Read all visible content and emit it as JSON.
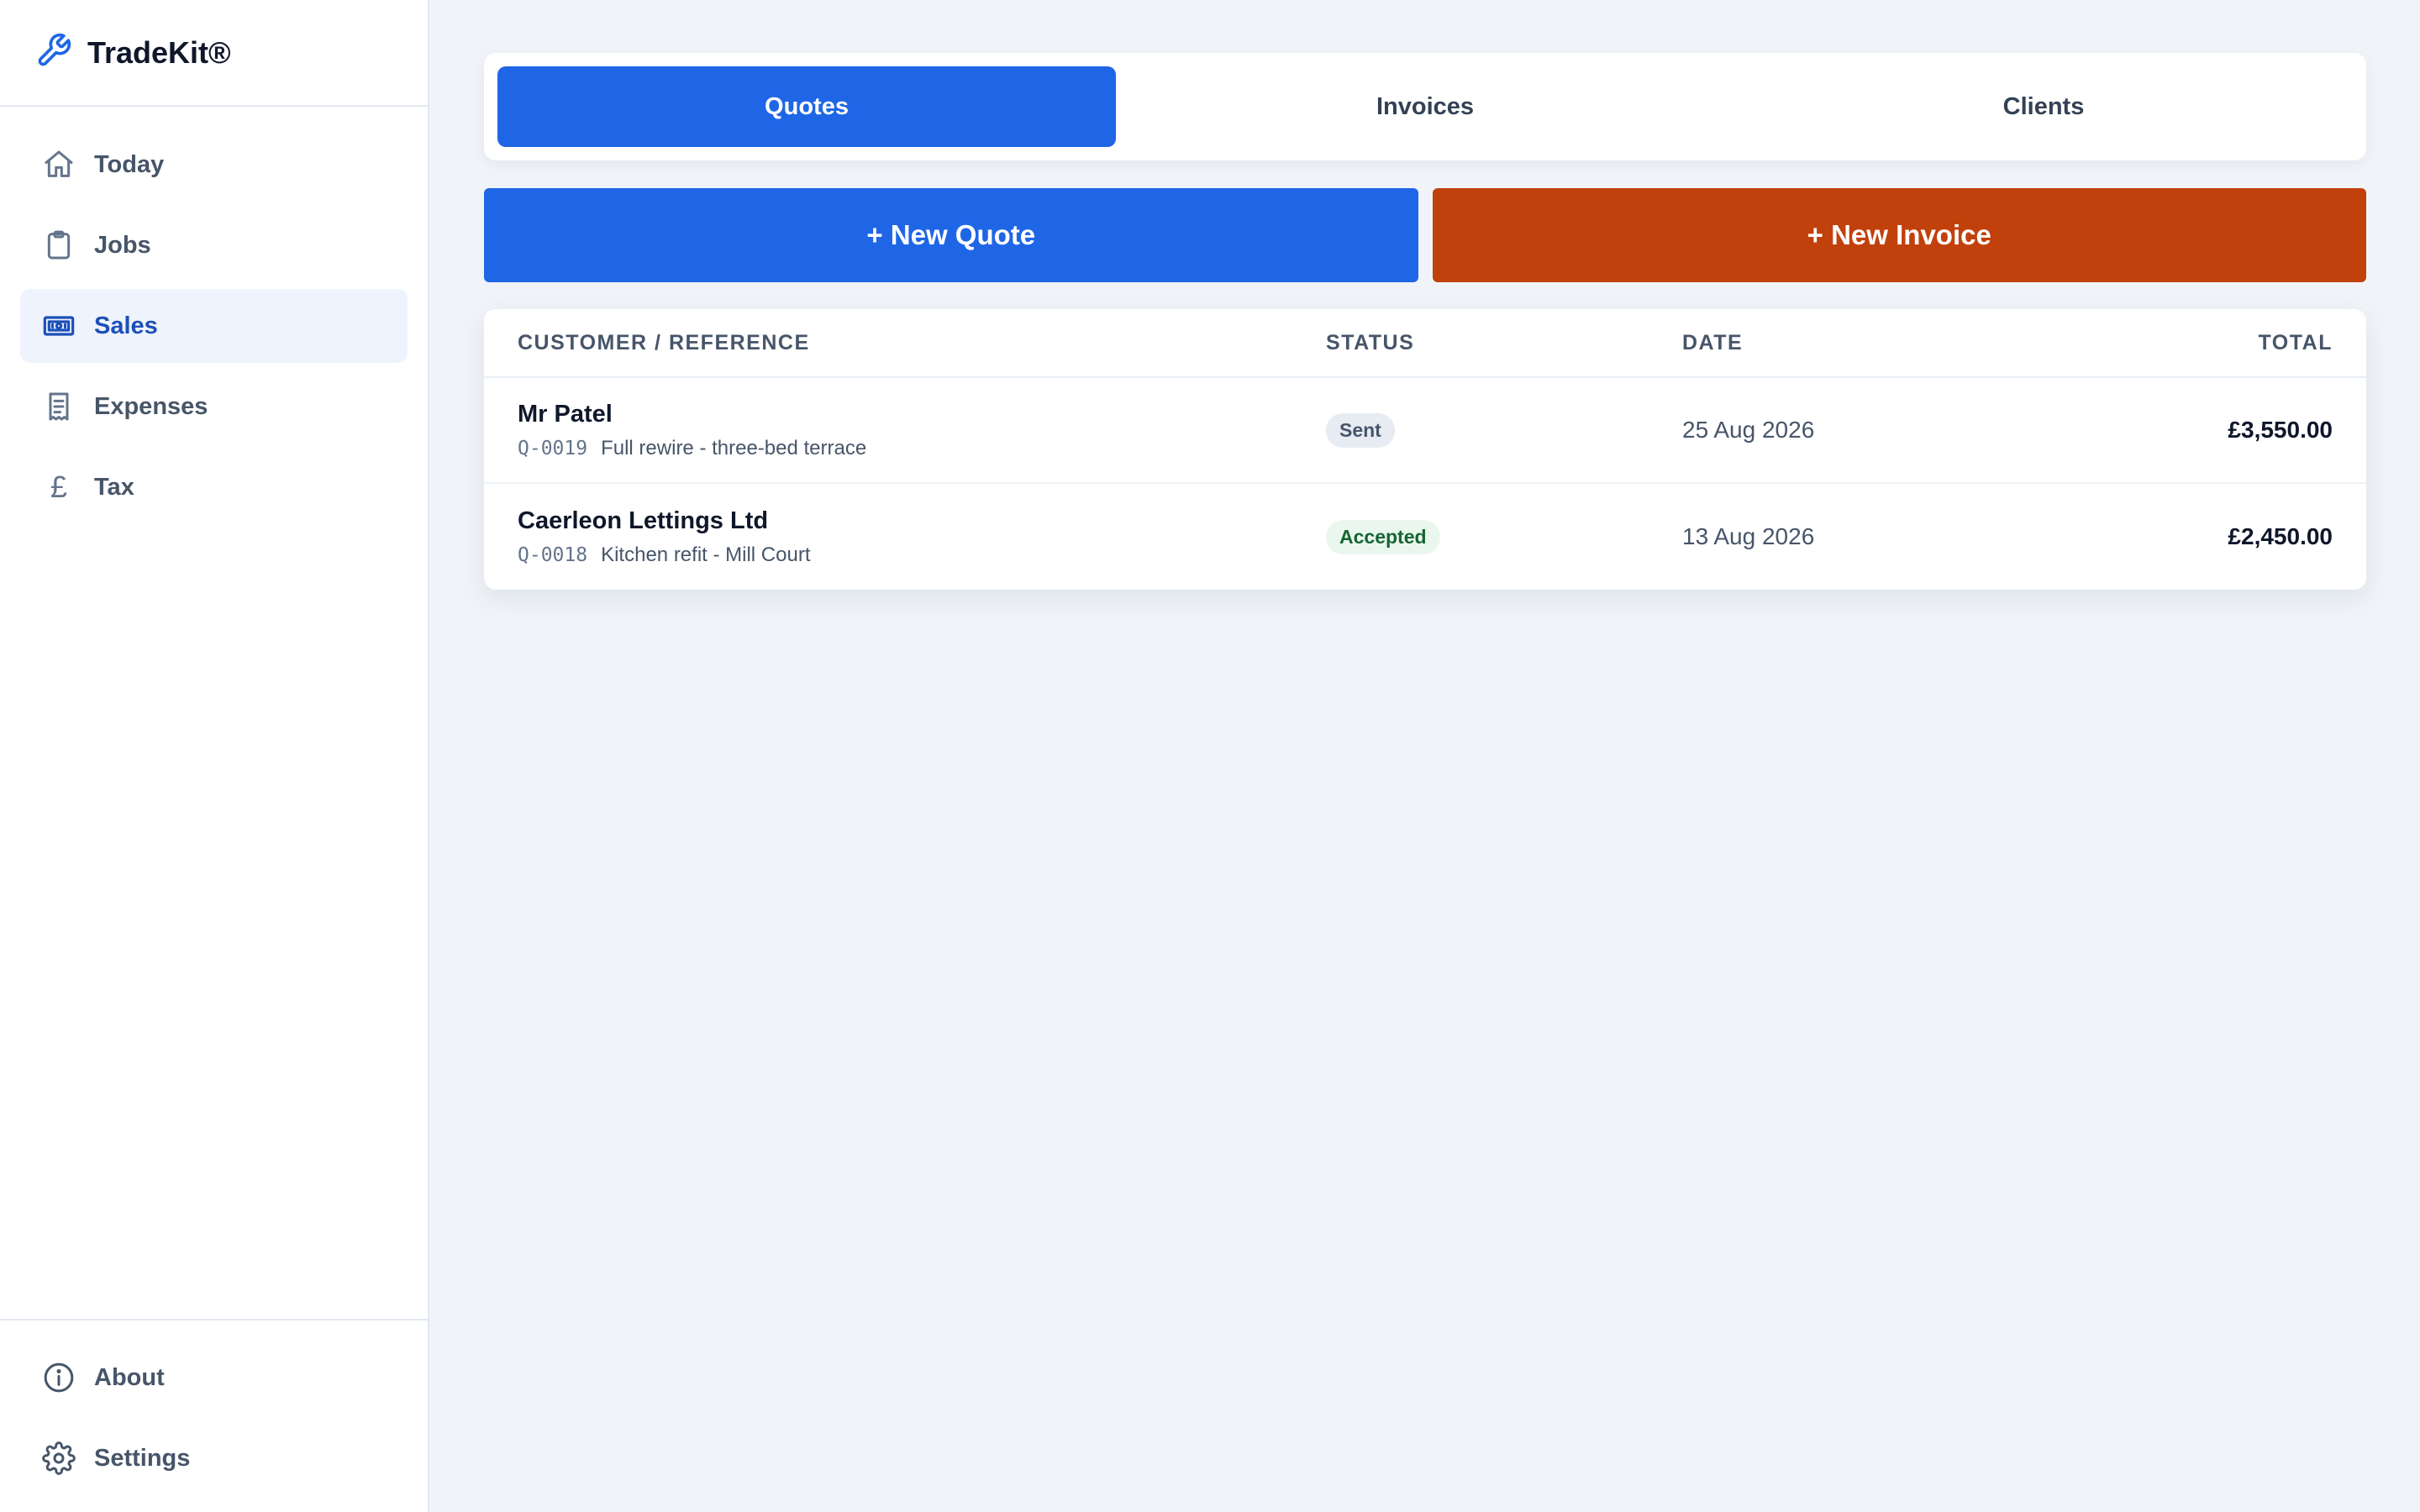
{
  "app": {
    "name": "TradeKit®",
    "icon": "wrench-icon",
    "accent": "#1f66e6"
  },
  "sidebar": {
    "items": [
      {
        "label": "Today",
        "icon": "home-icon",
        "active": false
      },
      {
        "label": "Jobs",
        "icon": "clipboard-icon",
        "active": false
      },
      {
        "label": "Sales",
        "icon": "banknote-icon",
        "active": true
      },
      {
        "label": "Expenses",
        "icon": "receipt-icon",
        "active": false
      },
      {
        "label": "Tax",
        "icon": "pound-icon",
        "active": false
      }
    ],
    "bottom": [
      {
        "label": "About",
        "icon": "info-icon"
      },
      {
        "label": "Settings",
        "icon": "gear-icon"
      }
    ]
  },
  "tabs": [
    {
      "label": "Quotes",
      "active": true
    },
    {
      "label": "Invoices",
      "active": false
    },
    {
      "label": "Clients",
      "active": false
    }
  ],
  "actions": {
    "new_quote": "+ New Quote",
    "new_invoice": "+ New Invoice",
    "quote_color": "#1f66e6",
    "invoice_color": "#c1410c"
  },
  "table": {
    "headers": {
      "customer": "CUSTOMER / REFERENCE",
      "status": "STATUS",
      "date": "DATE",
      "total": "TOTAL"
    },
    "rows": [
      {
        "customer": "Mr Patel",
        "ref": "Q-0019",
        "description": "Full rewire - three-bed terrace",
        "status": "Sent",
        "date": "25 Aug 2026",
        "total": "£3,550.00"
      },
      {
        "customer": "Caerleon Lettings Ltd",
        "ref": "Q-0018",
        "description": "Kitchen refit - Mill Court",
        "status": "Accepted",
        "date": "13 Aug 2026",
        "total": "£2,450.00"
      }
    ]
  }
}
